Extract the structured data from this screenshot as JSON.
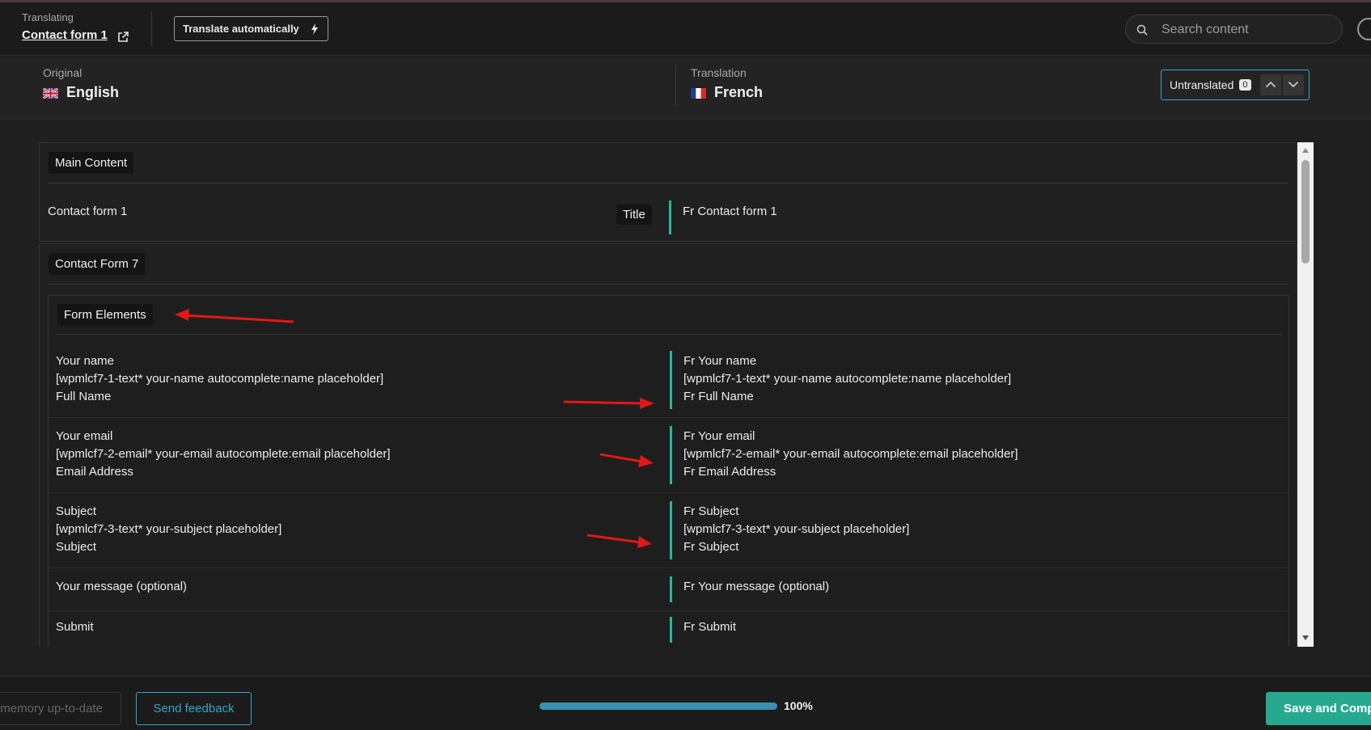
{
  "header": {
    "label": "Translating",
    "title": "Contact form 1",
    "auto_button": "Translate automatically",
    "search_placeholder": "Search content"
  },
  "languages": {
    "original_label": "Original",
    "original_name": "English",
    "translation_label": "Translation",
    "translation_name": "French",
    "filter_label": "Untranslated",
    "filter_count": "0"
  },
  "sections": {
    "main_content": {
      "tag": "Main Content",
      "row": {
        "original": "Contact form 1",
        "field_tag": "Title",
        "translation": "Fr Contact form 1"
      }
    },
    "cf7": {
      "tag": "Contact Form 7",
      "subsection_tag": "Form Elements",
      "rows": [
        {
          "original": "Your name\n[wpmlcf7-1-text* your-name autocomplete:name placeholder]\nFull Name",
          "translation": "Fr Your name\n[wpmlcf7-1-text* your-name autocomplete:name placeholder]\nFr Full Name"
        },
        {
          "original": "Your email\n[wpmlcf7-2-email* your-email autocomplete:email placeholder]\nEmail Address",
          "translation": "Fr Your email\n[wpmlcf7-2-email* your-email autocomplete:email placeholder]\nFr Email Address"
        },
        {
          "original": "Subject\n[wpmlcf7-3-text* your-subject placeholder]\nSubject",
          "translation": "Fr Subject\n[wpmlcf7-3-text* your-subject placeholder]\nFr Subject"
        },
        {
          "original": "Your message (optional)",
          "translation": "Fr Your message (optional)"
        },
        {
          "original": "Submit",
          "translation": "Fr Submit"
        }
      ]
    }
  },
  "footer": {
    "memory_button": "memory up-to-date",
    "feedback_button": "Send feedback",
    "progress": 1.0,
    "progress_text": "100%",
    "save_button": "Save and Complete"
  },
  "colors": {
    "accent_teal": "#2bb59d",
    "accent_blue": "#35a7c6",
    "save_green": "#27a98f",
    "annotation_red": "#e01818"
  }
}
